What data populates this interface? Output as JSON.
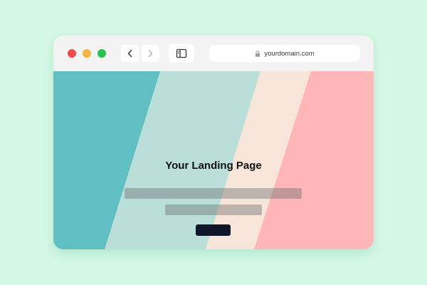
{
  "browser": {
    "url": "yourdomain.com",
    "icons": {
      "close": "close-traffic-light",
      "minimize": "minimize-traffic-light",
      "maximize": "maximize-traffic-light",
      "back": "chevron-left-icon",
      "forward": "chevron-right-icon",
      "sidebar": "sidebar-icon",
      "lock": "lock-icon"
    },
    "colors": {
      "close": "#f04d4a",
      "minimize": "#f5b541",
      "maximize": "#29c24f",
      "chrome": "#f3f3f3"
    }
  },
  "page": {
    "title": "Your Landing Page",
    "colors": {
      "stripe_teal": "#5fbfc2",
      "stripe_mint": "#b9dfd8",
      "stripe_cream": "#f8e5da",
      "stripe_pink": "#ffb6b8",
      "button": "#0f172a",
      "background": "#d4f8e6"
    }
  }
}
